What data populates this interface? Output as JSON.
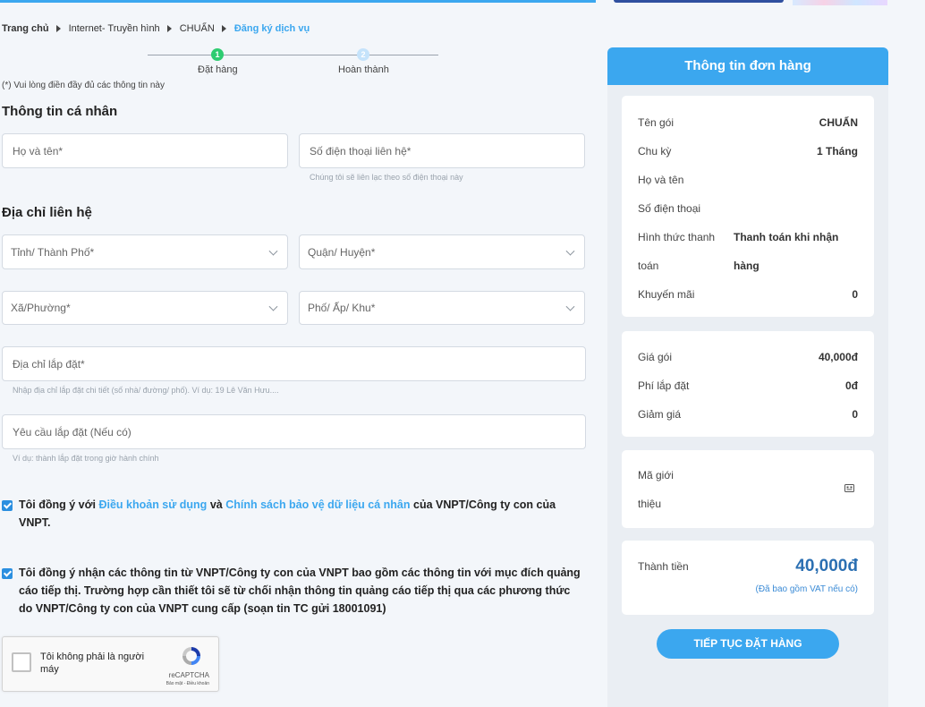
{
  "breadcrumb": {
    "items": [
      "Trang chủ",
      "Internet- Truyền hình",
      "CHUẨN",
      "Đăng ký dịch vụ"
    ]
  },
  "stepper": {
    "steps": [
      {
        "number": "1",
        "label": "Đặt hàng"
      },
      {
        "number": "2",
        "label": "Hoàn thành"
      }
    ]
  },
  "form": {
    "note": "(*) Vui lòng điền đầy đủ các thông tin này",
    "personal_title": "Thông tin cá nhân",
    "name_placeholder": "Họ và tên*",
    "phone_placeholder": "Số điện thoại liên hệ*",
    "phone_hint": "Chúng tôi sẽ liên lạc theo số điện thoại này",
    "address_title": "Địa chỉ liên hệ",
    "province_placeholder": "Tỉnh/ Thành Phố*",
    "district_placeholder": "Quận/ Huyện*",
    "ward_placeholder": "Xã/Phường*",
    "street_placeholder": "Phố/ Ấp/ Khu*",
    "install_address_placeholder": "Địa chỉ lắp đặt*",
    "install_address_hint": "Nhập địa chỉ lắp đặt chi tiết (số nhà/ đường/ phố). Ví dụ: 19 Lê Văn Hưu....",
    "install_request_placeholder": "Yêu cầu lắp đặt (Nếu có)",
    "install_request_hint": "Ví dụ: thành lắp đặt trong giờ hành chính"
  },
  "agreements": {
    "terms_prefix": "Tôi đồng ý với",
    "terms_link": "Điều khoản sử dụng",
    "terms_and": "và",
    "privacy_link": "Chính sách bảo vệ dữ liệu cá nhân",
    "terms_suffix": "của VNPT/Công ty con của VNPT.",
    "marketing_text": "Tôi đồng ý nhận các thông tin từ VNPT/Công ty con của VNPT bao gồm các thông tin với mục đích quảng cáo tiếp thị. Trường hợp cần thiết tôi sẽ từ chối nhận thông tin quảng cáo tiếp thị qua các phương thức do VNPT/Công ty con của VNPT cung cấp (soạn tin TC gửi 18001091)"
  },
  "recaptcha": {
    "label": "Tôi không phải là người máy",
    "brand": "reCAPTCHA",
    "terms": "Bảo mật - Điều khoản"
  },
  "order": {
    "title": "Thông tin đơn hàng",
    "package_label": "Tên gói",
    "package_value": "CHUẨN",
    "cycle_label": "Chu kỳ",
    "cycle_value": "1 Tháng",
    "name_label": "Họ và tên",
    "phone_label": "Số điện thoại",
    "payment_label_1": "Hình thức thanh",
    "payment_label_2": "toán",
    "payment_value_1": "Thanh toán khi nhận",
    "payment_value_2": "hàng",
    "promo_label": "Khuyến mãi",
    "promo_value": "0",
    "price_label": "Giá gói",
    "price_value": "40,000đ",
    "install_fee_label": "Phí lắp đặt",
    "install_fee_value": "0đ",
    "discount_label": "Giảm giá",
    "discount_value": "0",
    "referral_label_1": "Mã giới",
    "referral_label_2": "thiệu",
    "total_label": "Thành tiền",
    "total_value": "40,000đ",
    "total_note": "(Đã bao gồm VAT nếu có)",
    "cta": "TIẾP TỤC ĐẶT HÀNG"
  },
  "colors": {
    "accent": "#3ba7ef",
    "success": "#2ecc71",
    "total": "#2b6fb2"
  }
}
